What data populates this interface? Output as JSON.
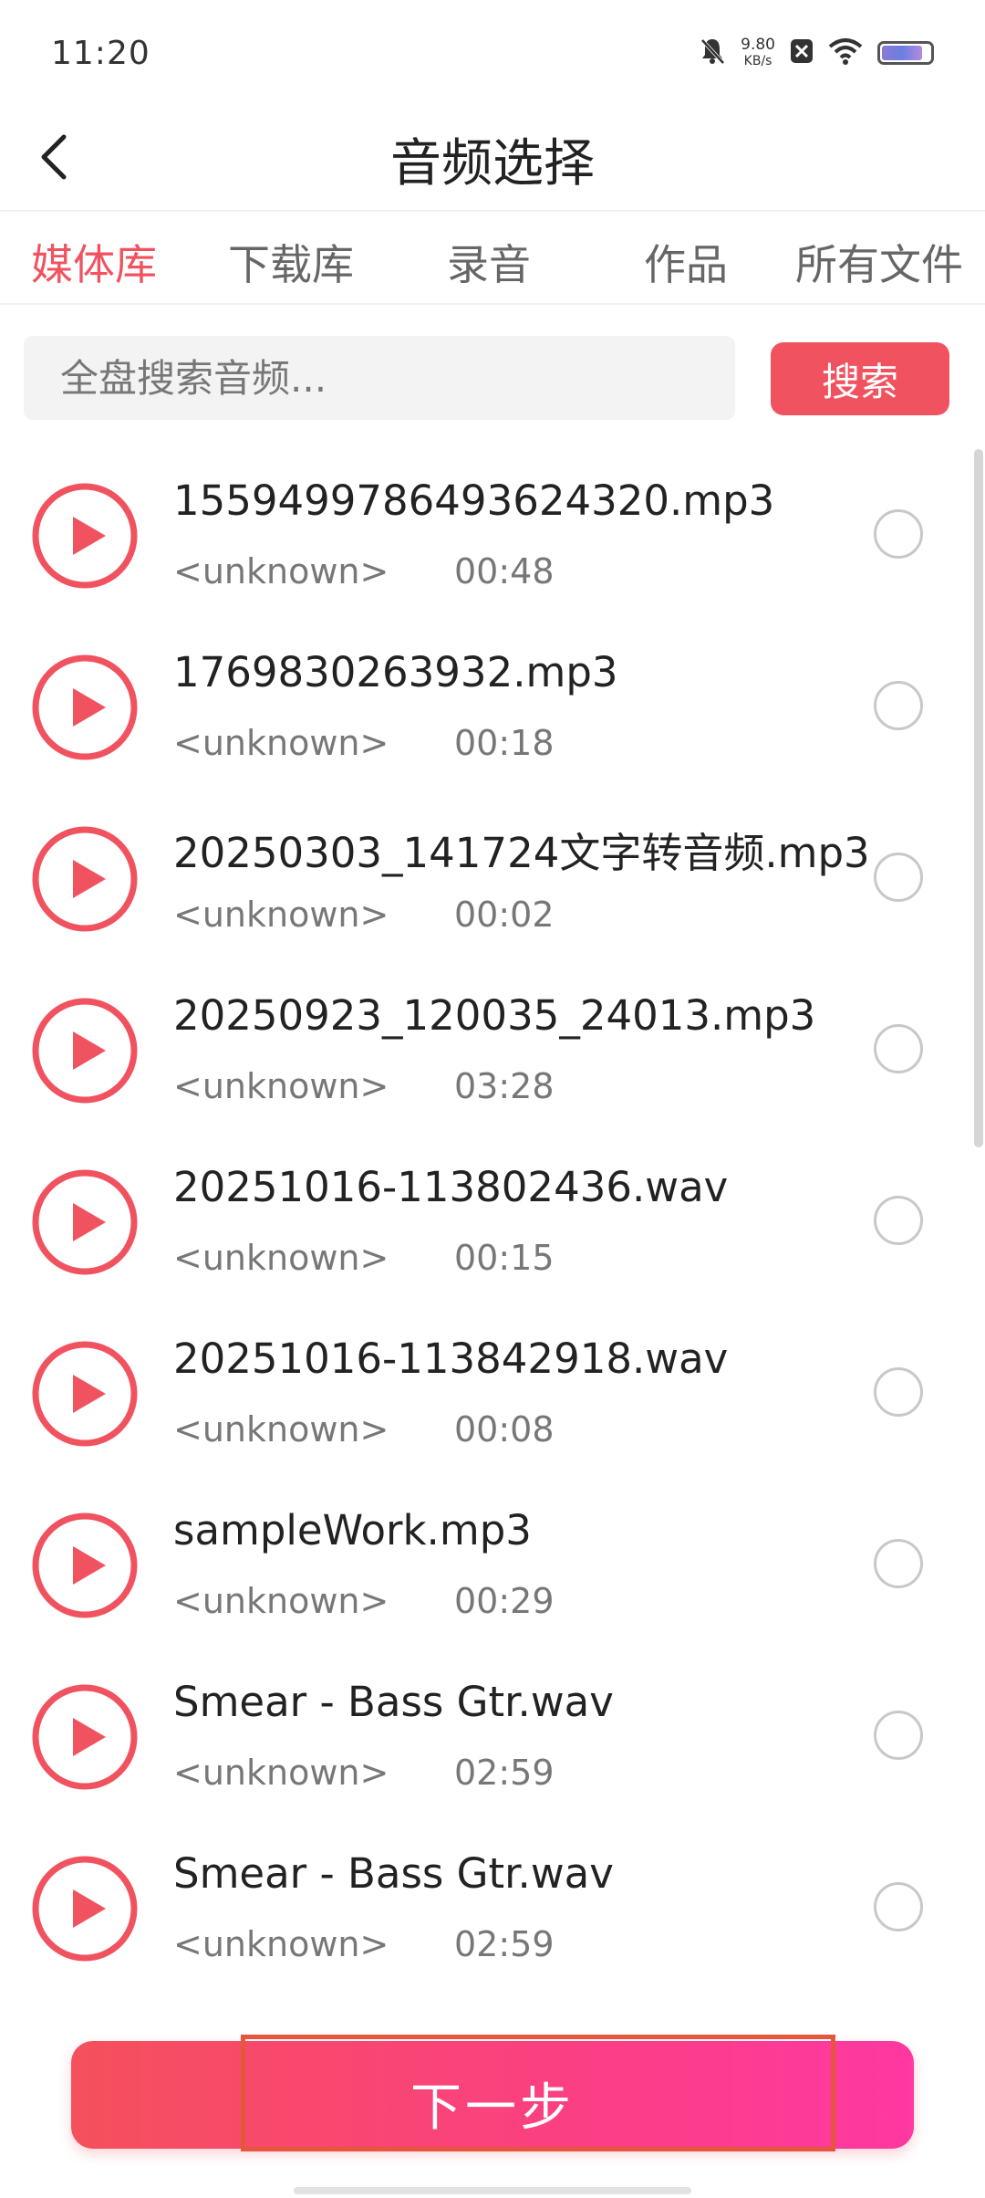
{
  "status_bar": {
    "time": "11:20",
    "net_speed": "9.80",
    "net_unit": "KB/s",
    "battery_level": 0.85,
    "icons": [
      "bell-muted-icon",
      "app-notification-icon",
      "wifi-icon",
      "battery-icon"
    ]
  },
  "header": {
    "title": "音频选择",
    "back_icon": "chevron-left-icon"
  },
  "tabs": [
    {
      "label": "媒体库",
      "active": true
    },
    {
      "label": "下载库",
      "active": false
    },
    {
      "label": "录音",
      "active": false
    },
    {
      "label": "作品",
      "active": false
    },
    {
      "label": "所有文件",
      "active": false
    }
  ],
  "search": {
    "placeholder": "全盘搜索音频...",
    "value": "",
    "button_label": "搜索"
  },
  "files": [
    {
      "name": "1559499786493624320.mp3",
      "artist": "<unknown>",
      "duration": "00:48",
      "selected": false
    },
    {
      "name": "1769830263932.mp3",
      "artist": "<unknown>",
      "duration": "00:18",
      "selected": false
    },
    {
      "name": "20250303_141724文字转音频.mp3",
      "artist": "<unknown>",
      "duration": "00:02",
      "selected": false
    },
    {
      "name": "20250923_120035_24013.mp3",
      "artist": "<unknown>",
      "duration": "03:28",
      "selected": false
    },
    {
      "name": "20251016-113802436.wav",
      "artist": "<unknown>",
      "duration": "00:15",
      "selected": false
    },
    {
      "name": "20251016-113842918.wav",
      "artist": "<unknown>",
      "duration": "00:08",
      "selected": false
    },
    {
      "name": "sampleWork.mp3",
      "artist": "<unknown>",
      "duration": "00:29",
      "selected": false
    },
    {
      "name": "Smear - Bass Gtr.wav",
      "artist": "<unknown>",
      "duration": "02:59",
      "selected": false
    },
    {
      "name": "Smear - Bass Gtr.wav",
      "artist": "<unknown>",
      "duration": "02:59",
      "selected": false
    }
  ],
  "footer": {
    "next_label": "下一步"
  },
  "colors": {
    "accent": "#f0535f",
    "gradient_end": "#ff38a2",
    "highlight": "#e8553d"
  }
}
